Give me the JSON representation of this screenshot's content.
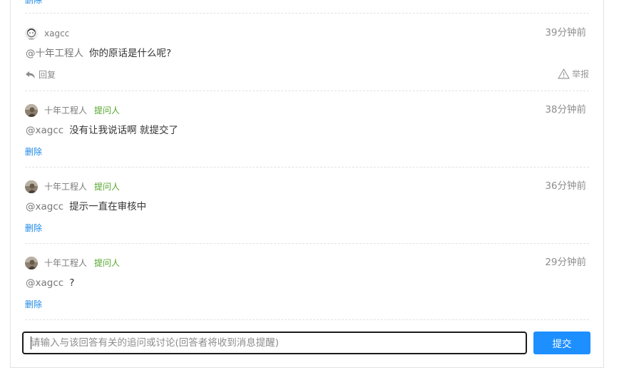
{
  "top": {
    "delete_label": "删除"
  },
  "comments": [
    {
      "username": "xagcc",
      "asker_badge": "",
      "time": "39分钟前",
      "mention": "@十年工程人",
      "text": "你的原话是什么呢?",
      "action": "回复",
      "report": "举报"
    },
    {
      "username": "十年工程人",
      "asker_badge": "提问人",
      "time": "38分钟前",
      "mention": "@xagcc",
      "text": "没有让我说话啊 就提交了",
      "action": "删除"
    },
    {
      "username": "十年工程人",
      "asker_badge": "提问人",
      "time": "36分钟前",
      "mention": "@xagcc",
      "text": "提示一直在审核中",
      "action": "删除"
    },
    {
      "username": "十年工程人",
      "asker_badge": "提问人",
      "time": "29分钟前",
      "mention": "@xagcc",
      "text": "?",
      "action": "删除"
    }
  ],
  "composer": {
    "placeholder": "请输入与该回答有关的追问或讨论(回答者将收到消息提醒)",
    "value": "",
    "submit_label": "提交"
  },
  "colors": {
    "link": "#1e88e5",
    "asker_badge": "#52a62a",
    "submit_bg": "#1e8fff",
    "divider": "#e2e2e2"
  },
  "icons": {
    "reply": "reply-arrow-icon",
    "report": "warning-triangle-icon",
    "avatar_xagcc": "avatar-sketch",
    "avatar_asker": "avatar-photo"
  }
}
